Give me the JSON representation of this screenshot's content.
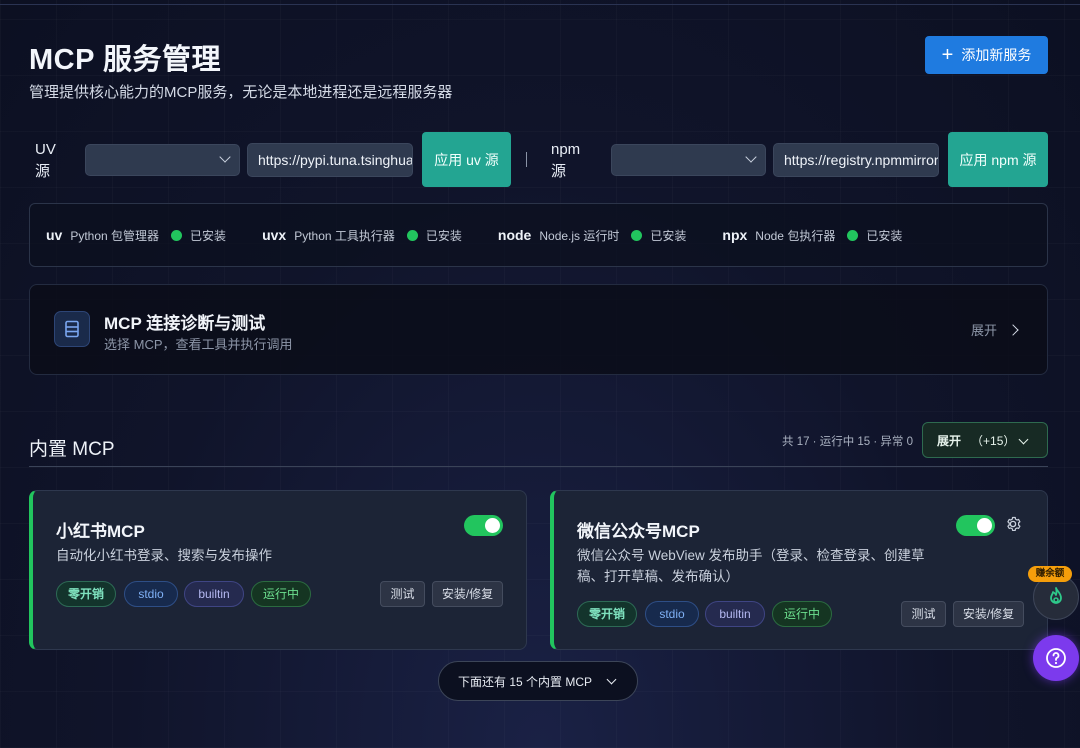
{
  "header": {
    "title": "MCP 服务管理",
    "subtitle": "管理提供核心能力的MCP服务，无论是本地进程还是远程服务器",
    "add_button_label": "添加新服务",
    "add_icon": "plus-icon"
  },
  "sources": {
    "uv": {
      "label": "UV 源",
      "selected": "",
      "url": "https://pypi.tuna.tsinghua.edu.cn/simple",
      "apply_label": "应用 uv 源"
    },
    "separator": "|",
    "npm": {
      "label": "npm 源",
      "selected": "",
      "url": "https://registry.npmmirror.com",
      "apply_label": "应用 npm 源"
    }
  },
  "tools": [
    {
      "name": "uv",
      "desc": "Python 包管理器",
      "status": "已安装"
    },
    {
      "name": "uvx",
      "desc": "Python 工具执行器",
      "status": "已安装"
    },
    {
      "name": "node",
      "desc": "Node.js 运行时",
      "status": "已安装"
    },
    {
      "name": "npx",
      "desc": "Node 包执行器",
      "status": "已安装"
    }
  ],
  "diagnostics": {
    "title": "MCP 连接诊断与测试",
    "subtitle": "选择 MCP，查看工具并执行调用",
    "expand_label": "展开",
    "icon": "diagnostic-icon"
  },
  "builtin": {
    "title": "内置 MCP",
    "stats": "共 17 · 运行中 15 · 异常 0",
    "expand_label": "展开",
    "expand_count": "（+15）",
    "more_label": "下面还有 15 个内置 MCP"
  },
  "cards": [
    {
      "title": "小红书MCP",
      "desc": "自动化小红书登录、搜索与发布操作",
      "enabled": true,
      "tags": [
        "零开销",
        "stdio",
        "builtin",
        "运行中"
      ],
      "test_label": "测试",
      "repair_label": "安装/修复"
    },
    {
      "title": "微信公众号MCP",
      "desc_line1": "微信公众号 WebView 发布助手（登录、检查登录、创建草",
      "desc_line2": "稿、打开草稿、发布确认）",
      "enabled": true,
      "tags": [
        "零开销",
        "stdio",
        "builtin",
        "运行中"
      ],
      "test_label": "测试",
      "repair_label": "安装/修复",
      "settings_icon": "gear-icon"
    }
  ],
  "floating": {
    "badge": "赚余额",
    "fire_icon": "fire-icon",
    "help_icon": "help-icon"
  },
  "colors": {
    "accent_blue": "#1f7be0",
    "teal": "#23a592",
    "green": "#22c55e",
    "purple": "#7c3aed"
  }
}
